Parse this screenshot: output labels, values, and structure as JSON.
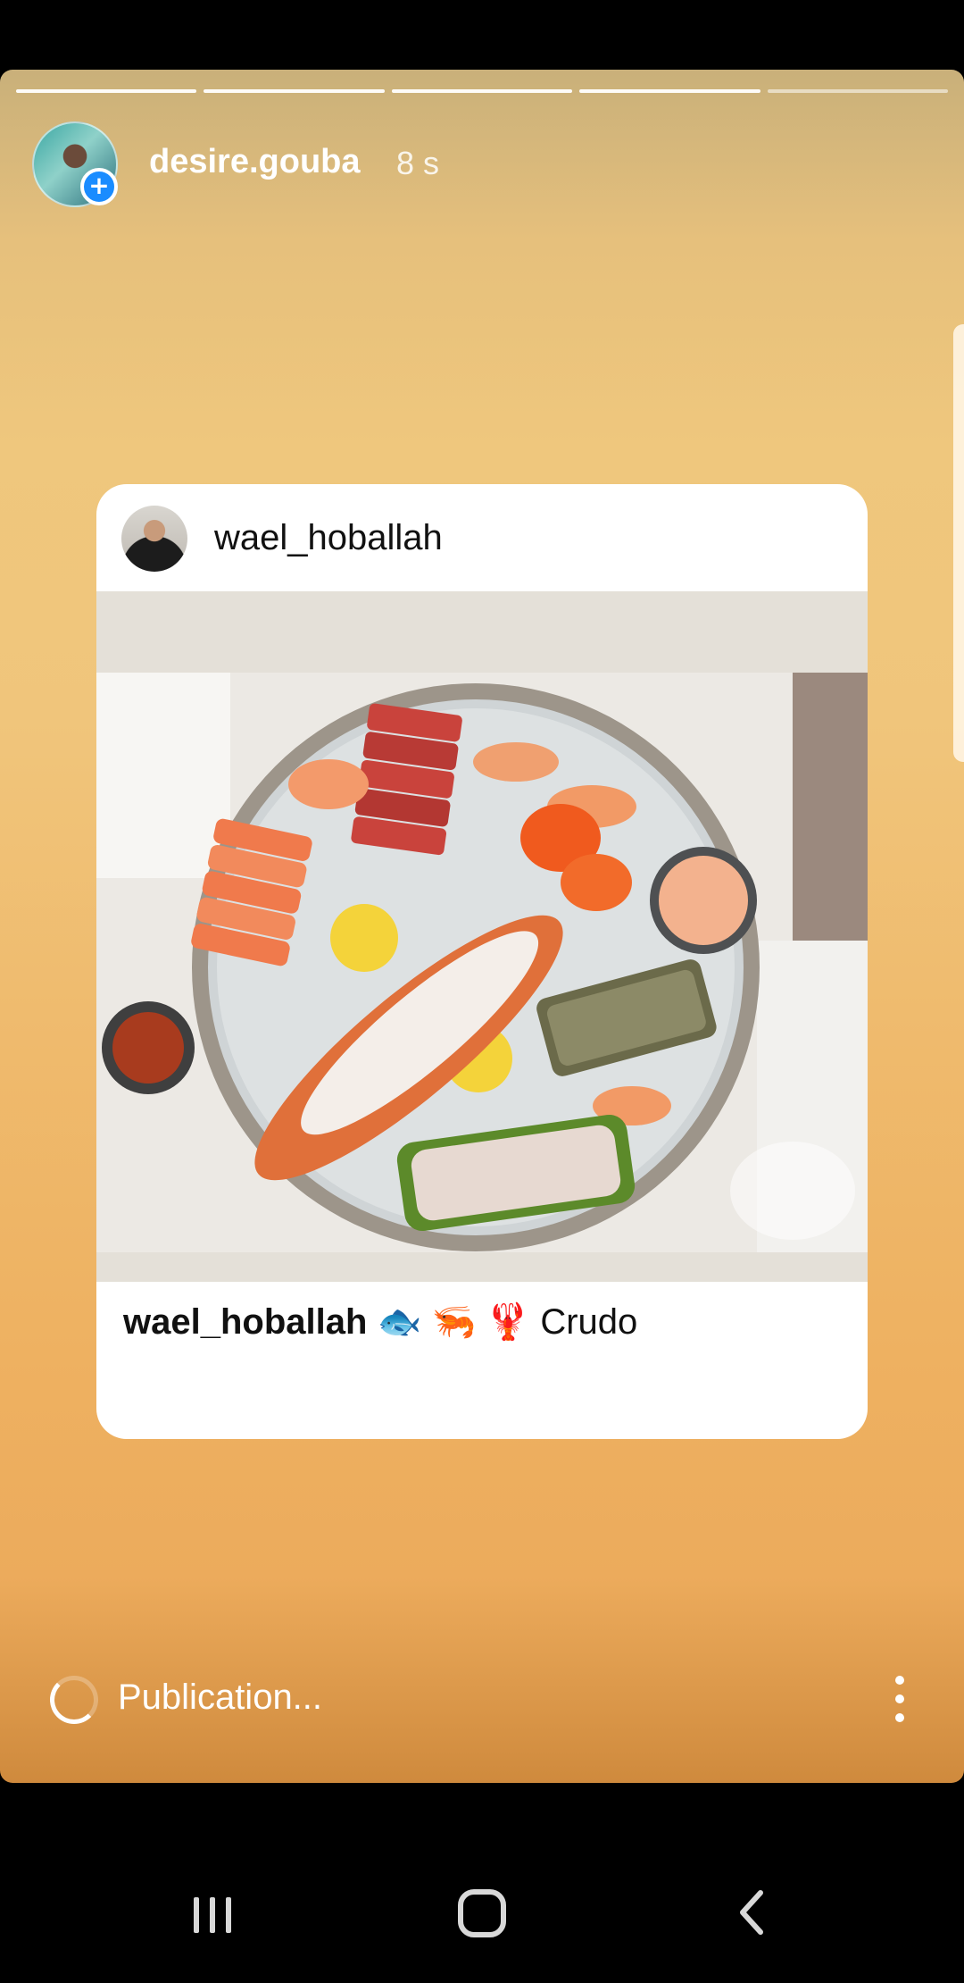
{
  "story": {
    "username": "desire.gouba",
    "time": "8 s",
    "progress_segments": [
      1,
      1,
      1,
      1,
      0
    ]
  },
  "card": {
    "author": "wael_hoballah",
    "caption_user": "wael_hoballah",
    "caption_emojis": "🐟 🦐 🦞",
    "caption_text": "Crudo"
  },
  "footer": {
    "status": "Publication..."
  },
  "colors": {
    "accent_blue": "#1a8cff",
    "story_top": "#c9b07a",
    "story_bottom": "#cf8a3d"
  },
  "icons": [
    "add-icon",
    "loading-spinner-icon",
    "more-vertical-icon",
    "recents-icon",
    "home-icon",
    "back-icon"
  ]
}
